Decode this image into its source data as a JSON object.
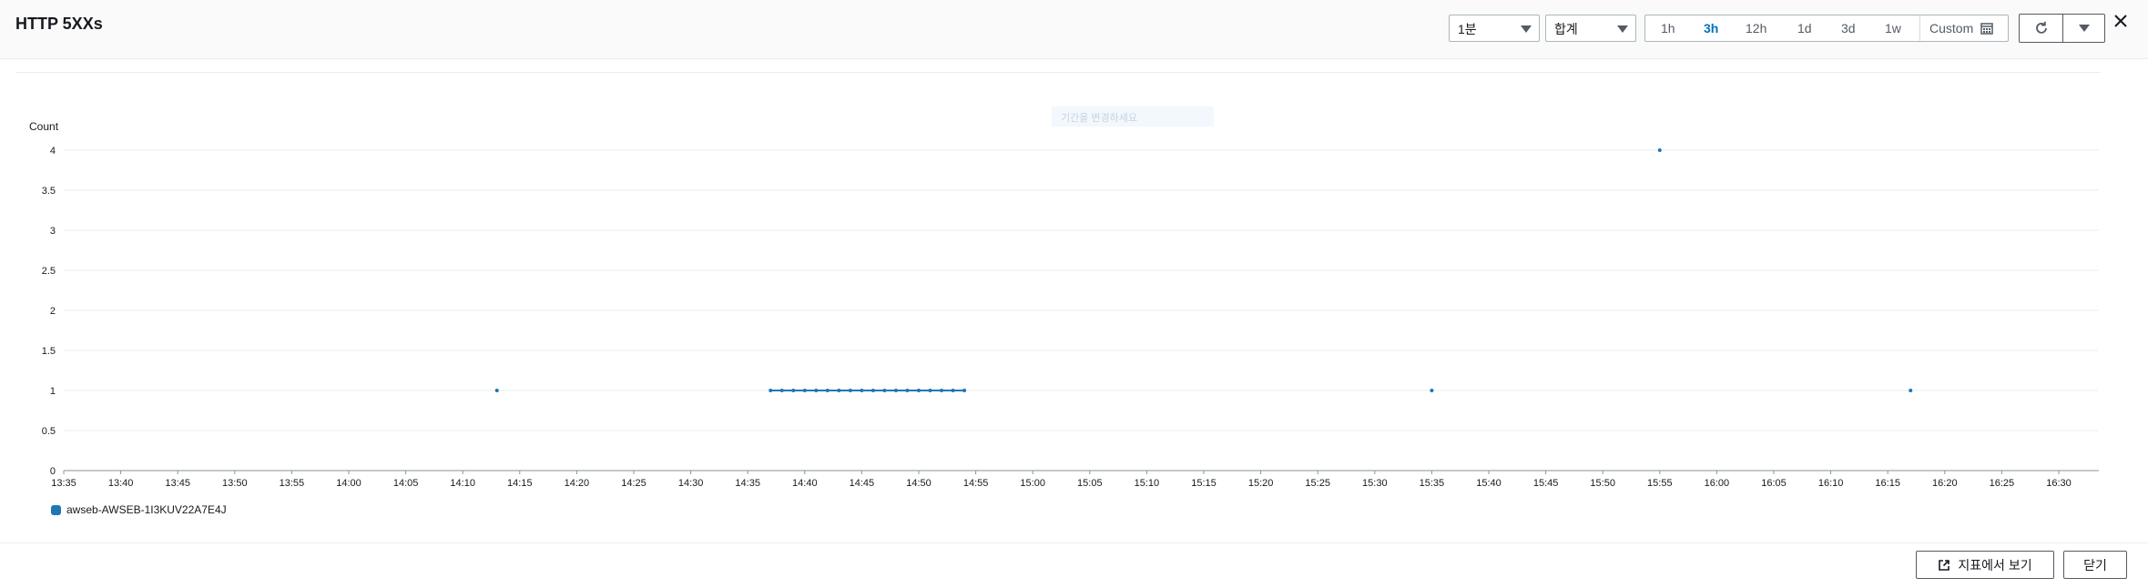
{
  "header": {
    "title": "HTTP 5XXs",
    "period_select": "1분",
    "statistic_select": "합계",
    "time_ranges": [
      "1h",
      "3h",
      "12h",
      "1d",
      "3d",
      "1w"
    ],
    "active_range": "3h",
    "custom_label": "Custom"
  },
  "tooltip_ghost": "기간을 변경하세요",
  "colors": {
    "series": "#1f77b4",
    "accent": "#0073bb"
  },
  "chart_data": {
    "type": "line",
    "ylabel": "Count",
    "ylim": [
      0,
      4
    ],
    "yticks": [
      "4",
      "3.5",
      "3",
      "2.5",
      "2",
      "1.5",
      "1",
      "0.5",
      "0"
    ],
    "xticks": [
      "13:35",
      "13:40",
      "13:45",
      "13:50",
      "13:55",
      "14:00",
      "14:05",
      "14:10",
      "14:15",
      "14:20",
      "14:25",
      "14:30",
      "14:35",
      "14:40",
      "14:45",
      "14:50",
      "14:55",
      "15:00",
      "15:05",
      "15:10",
      "15:15",
      "15:20",
      "15:25",
      "15:30",
      "15:35",
      "15:40",
      "15:45",
      "15:50",
      "15:55",
      "16:00",
      "16:05",
      "16:10",
      "16:15",
      "16:20",
      "16:25",
      "16:30"
    ],
    "grid": true,
    "legend_position": "bottom-left",
    "series": [
      {
        "name": "awseb-AWSEB-1I3KUV22A7E4J",
        "points": [
          {
            "x": "14:13",
            "y": 1
          },
          {
            "x": "14:37",
            "y": 1
          },
          {
            "x": "14:38",
            "y": 1
          },
          {
            "x": "14:39",
            "y": 1
          },
          {
            "x": "14:40",
            "y": 1
          },
          {
            "x": "14:41",
            "y": 1
          },
          {
            "x": "14:42",
            "y": 1
          },
          {
            "x": "14:43",
            "y": 1
          },
          {
            "x": "14:44",
            "y": 1
          },
          {
            "x": "14:45",
            "y": 1
          },
          {
            "x": "14:46",
            "y": 1
          },
          {
            "x": "14:47",
            "y": 1
          },
          {
            "x": "14:48",
            "y": 1
          },
          {
            "x": "14:49",
            "y": 1
          },
          {
            "x": "14:50",
            "y": 1
          },
          {
            "x": "14:51",
            "y": 1
          },
          {
            "x": "14:52",
            "y": 1
          },
          {
            "x": "14:53",
            "y": 1
          },
          {
            "x": "14:54",
            "y": 1
          },
          {
            "x": "15:35",
            "y": 1
          },
          {
            "x": "15:55",
            "y": 4
          },
          {
            "x": "16:17",
            "y": 1
          }
        ]
      }
    ]
  },
  "footer": {
    "view_in_metrics": "지표에서 보기",
    "close": "닫기"
  }
}
